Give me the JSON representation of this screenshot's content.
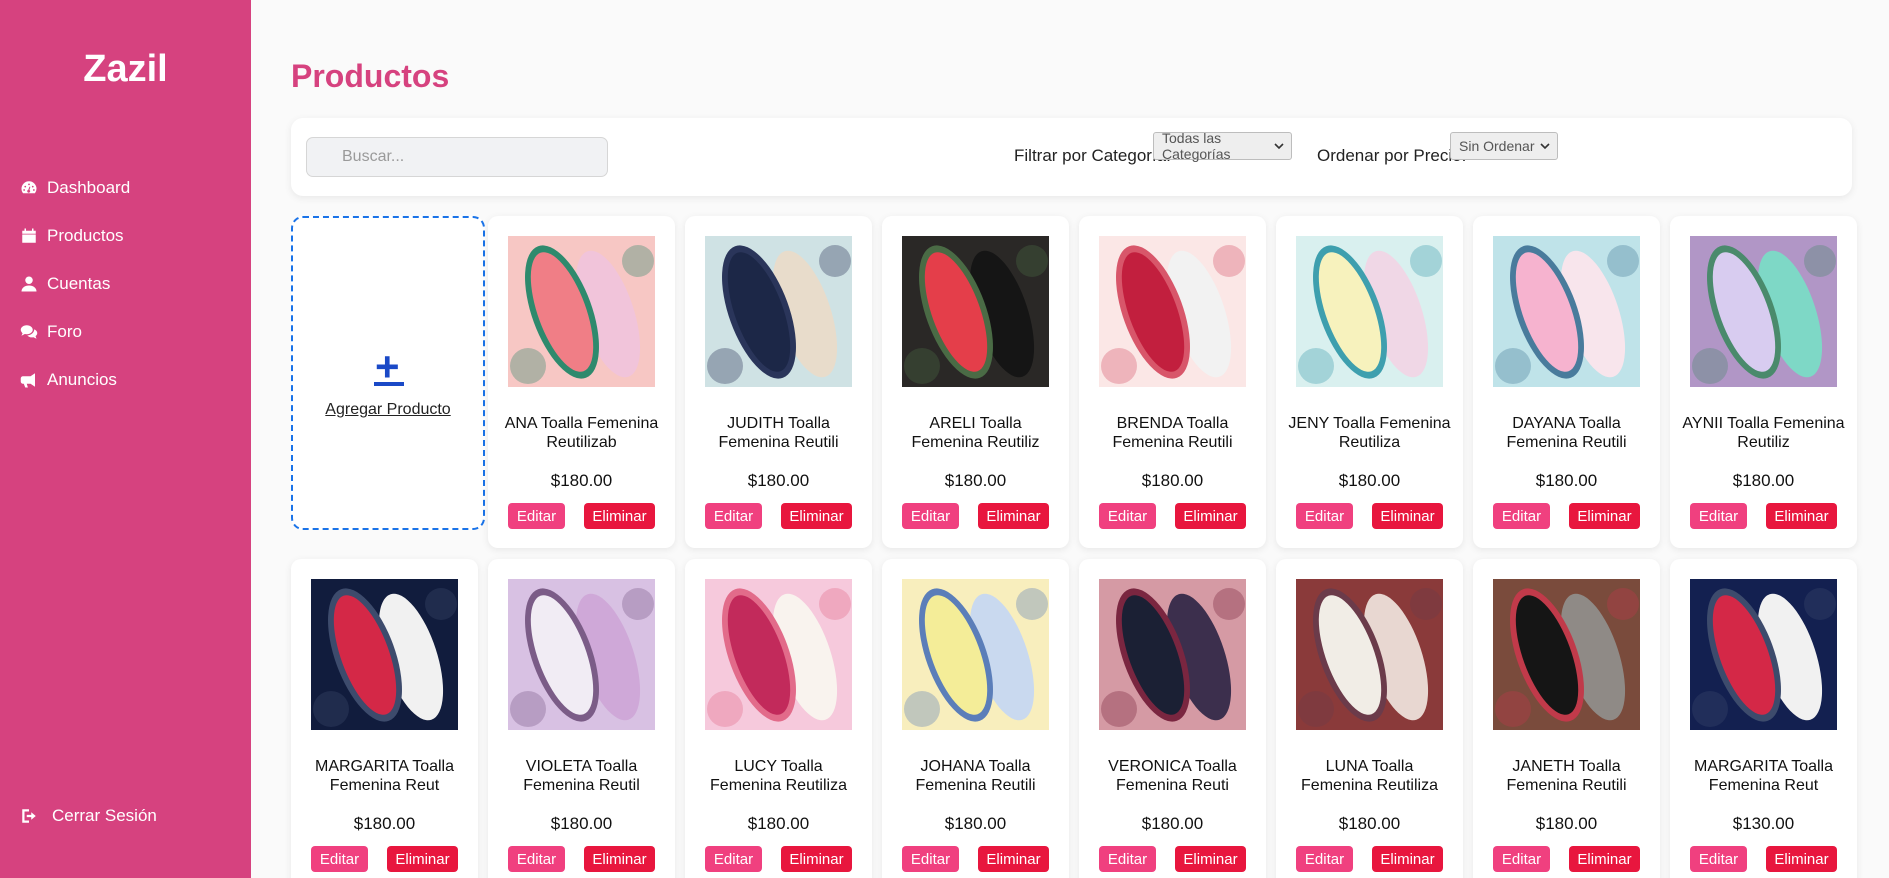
{
  "app": {
    "brand": "Zazil"
  },
  "sidebar": {
    "items": [
      {
        "label": "Dashboard",
        "icon": "dashboard-icon"
      },
      {
        "label": "Productos",
        "icon": "calendar-icon"
      },
      {
        "label": "Cuentas",
        "icon": "user-icon"
      },
      {
        "label": "Foro",
        "icon": "comments-icon"
      },
      {
        "label": "Anuncios",
        "icon": "megaphone-icon"
      }
    ],
    "logout_label": "Cerrar Sesión"
  },
  "main": {
    "title": "Productos",
    "search": {
      "placeholder": "Buscar...",
      "value": ""
    },
    "filter": {
      "label": "Filtrar por Categoría:",
      "selected": "Todas las Categorías"
    },
    "sort": {
      "label": "Ordenar por Precio:",
      "selected": "Sin Ordenar"
    },
    "add_product_label": "Agregar Producto",
    "add_symbol": "+",
    "edit_label": "Editar",
    "delete_label": "Eliminar"
  },
  "products": [
    {
      "name": "ANA Toalla Femenina Reutilizab",
      "price": "$180.00",
      "bg": "#f7c7c4",
      "pad": "#f07e86",
      "pad2": "#f1c4da",
      "trim": "#2e8a6d"
    },
    {
      "name": "JUDITH Toalla Femenina Reutili",
      "price": "$180.00",
      "bg": "#cfe2e4",
      "pad": "#1c2747",
      "pad2": "#e8dccb",
      "trim": "#2a355a"
    },
    {
      "name": "ARELI Toalla Femenina Reutiliz",
      "price": "$180.00",
      "bg": "#2a2826",
      "pad": "#e43e4a",
      "pad2": "#151515",
      "trim": "#4a6b45"
    },
    {
      "name": "BRENDA Toalla Femenina Reutili",
      "price": "$180.00",
      "bg": "#fbe7e6",
      "pad": "#c21f3e",
      "pad2": "#f2f2f2",
      "trim": "#d8566a"
    },
    {
      "name": "JENY Toalla Femenina Reutiliza",
      "price": "$180.00",
      "bg": "#d9f0ef",
      "pad": "#f7f2bd",
      "pad2": "#f0d7e6",
      "trim": "#3e9fae"
    },
    {
      "name": "DAYANA Toalla Femenina Reutili",
      "price": "$180.00",
      "bg": "#bfe3e9",
      "pad": "#f6b3cf",
      "pad2": "#f8e5ec",
      "trim": "#497b9c"
    },
    {
      "name": "AYNII Toalla Femenina Reutiliz",
      "price": "$180.00",
      "bg": "#b196c6",
      "pad": "#d8ccf0",
      "pad2": "#7ed8c6",
      "trim": "#4a8a6c"
    },
    {
      "name": "MARGARITA Toalla Femenina Reut",
      "price": "$180.00",
      "bg": "#111c3d",
      "pad": "#d42847",
      "pad2": "#f1f1f1",
      "trim": "#3d4b6c"
    },
    {
      "name": "VIOLETA Toalla Femenina Reutil",
      "price": "$180.00",
      "bg": "#d8c1e3",
      "pad": "#f1ecf4",
      "pad2": "#cfa8d8",
      "trim": "#7b5c87"
    },
    {
      "name": "LUCY Toalla Femenina Reutiliza",
      "price": "$180.00",
      "bg": "#f6c9dc",
      "pad": "#c22a5b",
      "pad2": "#f9f3ee",
      "trim": "#e26b8a"
    },
    {
      "name": "JOHANA Toalla Femenina Reutili",
      "price": "$180.00",
      "bg": "#f8eebd",
      "pad": "#f4ed98",
      "pad2": "#c9d9ef",
      "trim": "#5b7eb9"
    },
    {
      "name": "VERONICA Toalla Femenina Reuti",
      "price": "$180.00",
      "bg": "#d59aa4",
      "pad": "#1b2034",
      "pad2": "#3c2f4d",
      "trim": "#7a2640"
    },
    {
      "name": "LUNA Toalla Femenina Reutiliza",
      "price": "$180.00",
      "bg": "#8a3a3a",
      "pad": "#f1ede6",
      "pad2": "#e8d7d1",
      "trim": "#6b3b4a"
    },
    {
      "name": "JANETH Toalla Femenina Reutili",
      "price": "$180.00",
      "bg": "#7a4b3c",
      "pad": "#151515",
      "pad2": "#8f8a86",
      "trim": "#c13a4a"
    },
    {
      "name": "MARGARITA Toalla Femenina Reut",
      "price": "$130.00",
      "bg": "#132050",
      "pad": "#d42847",
      "pad2": "#f1f1f1",
      "trim": "#3d4b6c"
    }
  ]
}
